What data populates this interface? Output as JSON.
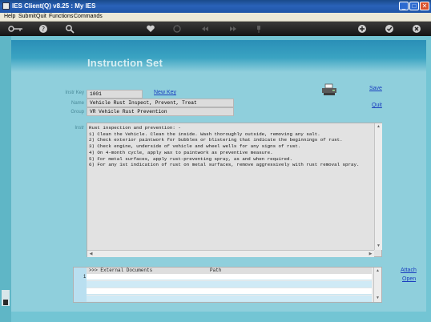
{
  "window": {
    "title": "IES Client(Q) v8.25 : My IES",
    "minimize_label": "_",
    "maximize_label": "□",
    "close_label": "✕"
  },
  "menu": {
    "help": "Help",
    "submit": "Submit",
    "quit": "Quit",
    "functions": "Functions",
    "commands": "Commands"
  },
  "toolbar": {
    "icons": [
      "key-icon",
      "help-icon",
      "search-icon",
      "heart-icon",
      "refresh-icon",
      "rewind-icon",
      "forward-icon",
      "pin-icon",
      "add-icon",
      "check-icon",
      "close-icon"
    ]
  },
  "page": {
    "title": "Instruction Set"
  },
  "form": {
    "instr_key_label": "Instr Key",
    "instr_key_value": "1001",
    "name_label": "Name",
    "name_value": "Vehicle Rust Inspect, Prevent, Treat",
    "group_label": "Group",
    "group_value": "VR Vehicle Rust Prevention",
    "instr_label": "Instr",
    "new_key_link": "New Key",
    "save_link": "Save",
    "quit_link": "Quit"
  },
  "instructions": {
    "text": "Rust inspection and prevention: -\n1) Clean the Vehicle. Clean the inside. Wash thoroughly outside, removing any salt.\n2) Check exterior paintwork for bubbles or blistering that indicate the beginnings of rust.\n3) Check engine, underside of vehicle and wheel wells for any signs of rust.\n4) On 4-month cycle, apply wax to paintwork as preventive measure.\n5) For metal surfaces, apply rust-preventing spray, as and when required.\n6) For any 1st indication of rust on metal surfaces, remove aggressively with rust removal spray."
  },
  "documents": {
    "header_prefix": ">>> External Documents",
    "header_path": "Path",
    "row_number": "1",
    "attach_link": "Attach",
    "open_link": "Open"
  },
  "colors": {
    "canvas": "#73c5d4",
    "frame": "#8fcfdc",
    "link": "#1b3fbf",
    "title_bar": "#1f55a8"
  }
}
